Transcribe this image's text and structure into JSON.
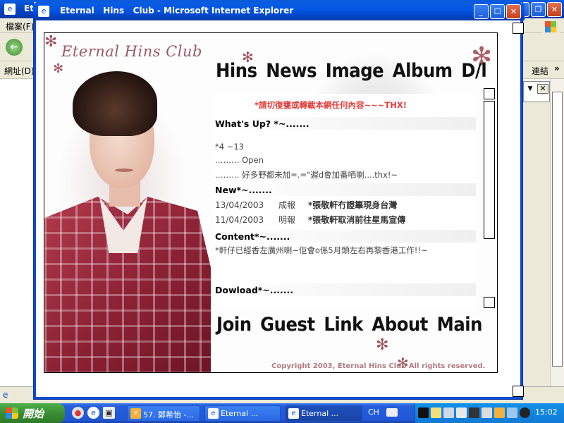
{
  "background_window": {
    "title": "Et",
    "menu_label": "檔案(F)",
    "address_label": "網址(D)",
    "links_label": "連結",
    "more_label": "»"
  },
  "popup": {
    "title": "Eternal   Hins   Club - Microsoft Internet Explorer"
  },
  "site": {
    "logo": "Eternal Hins Club",
    "nav_top": [
      "Hins",
      "News",
      "Image",
      "Album",
      "D/l"
    ],
    "notice": "*請切復甕或轉載本網任何內容~~~THX!",
    "whats_up": {
      "heading": "What's Up? *~.......",
      "lines": [
        "*4 ~13",
        "………   Open",
        "………   好多野都未加=.=\"遲d會加番哂喇....thx!~"
      ]
    },
    "news": {
      "heading": "New*~.......",
      "items": [
        {
          "date": "13/04/2003",
          "source": "成報",
          "headline": "*張敬軒冇證篳現身台灣"
        },
        {
          "date": "11/04/2003",
          "source": "明報",
          "headline": "*張敬軒取消前往星馬宣傳"
        }
      ]
    },
    "content": {
      "heading": "Content*~.......",
      "text": "*軒仔已經香左廣州喇~佢會o係5月頭左右再黎香港工作!!~"
    },
    "download": {
      "heading": "Dowload*~......."
    },
    "nav_bottom": [
      "Join",
      "Guest",
      "Link",
      "About",
      "Main"
    ],
    "copyright": "Copyright 2003, Eternal Hins Club All rights reserved."
  },
  "taskbar": {
    "start_label": "開始",
    "tasks": [
      {
        "label": "57. 鄭希怡 -..."
      },
      {
        "label": "Eternal    ..."
      },
      {
        "label": "Eternal    ..."
      }
    ],
    "language": "CH",
    "clock": "15:02"
  },
  "colors": {
    "notice": "#e2403c",
    "accent_flower": "#a0505c",
    "xp_blue": "#245edb"
  }
}
